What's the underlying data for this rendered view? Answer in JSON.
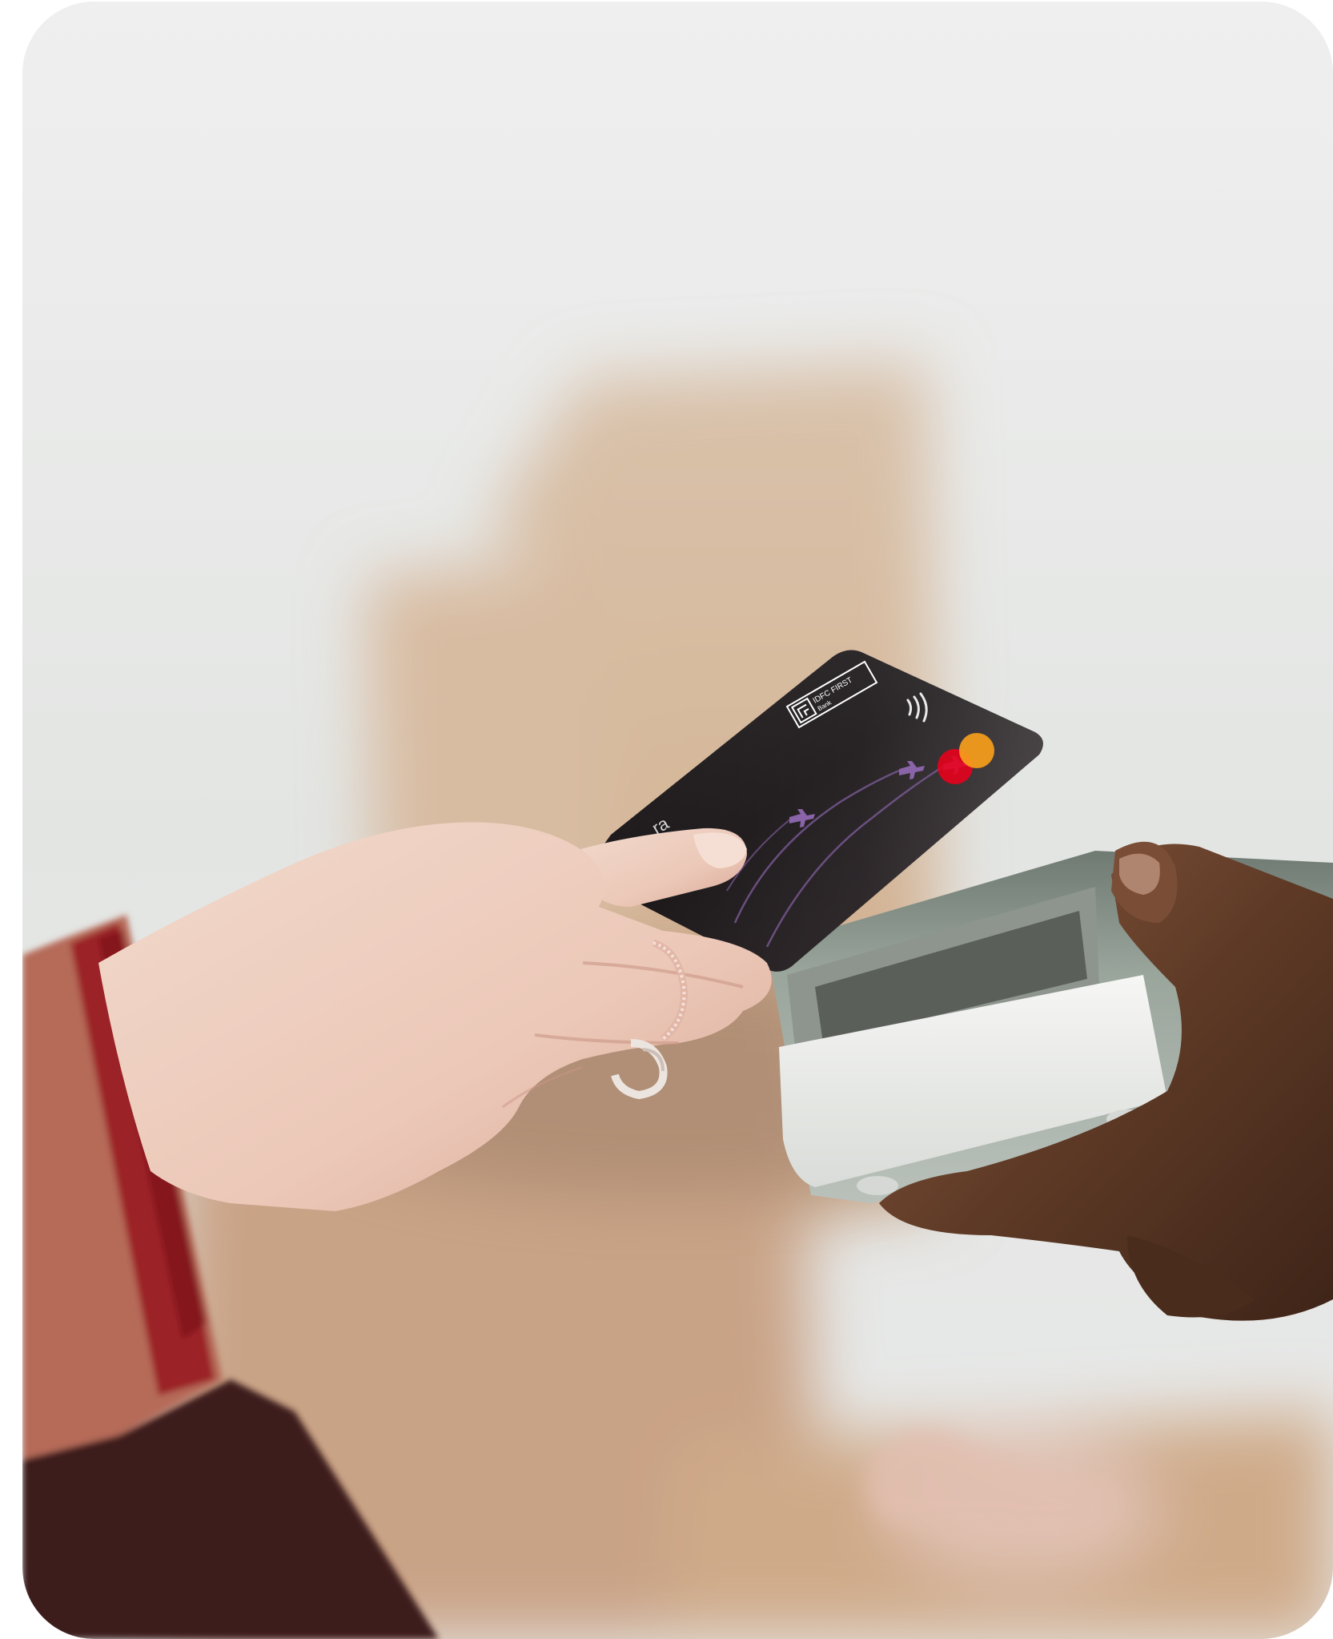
{
  "card": {
    "brand_line1": "IDFC FIRST",
    "brand_line2": "Bank",
    "partial_name": "ra"
  }
}
